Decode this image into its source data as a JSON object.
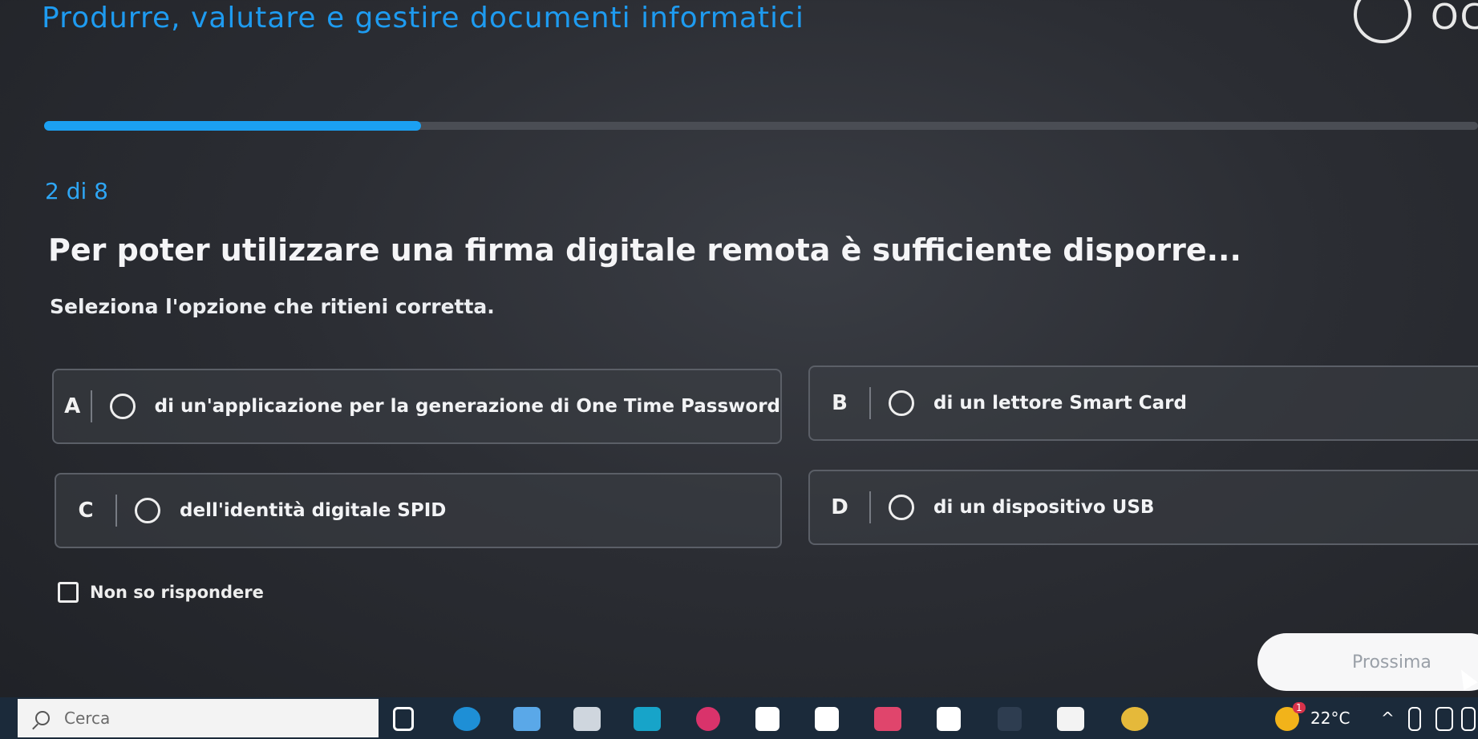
{
  "header": {
    "title": "Produrre, valutare e gestire documenti informatici",
    "timer_text": "OC"
  },
  "progress": {
    "fraction": 0.25,
    "counter": "2 di 8"
  },
  "question": {
    "text": "Per poter utilizzare una firma digitale remota è sufficiente disporre...",
    "instruction": "Seleziona l'opzione che ritieni corretta."
  },
  "options": [
    {
      "letter": "A",
      "label": "di un'applicazione per la generazione di One Time Password"
    },
    {
      "letter": "B",
      "label": "di un lettore Smart Card"
    },
    {
      "letter": "C",
      "label": "dell'identità digitale SPID"
    },
    {
      "letter": "D",
      "label": "di un dispositivo USB"
    }
  ],
  "no_answer": {
    "label": "Non so rispondere"
  },
  "next_button": {
    "label": "Prossima"
  },
  "taskbar": {
    "search_placeholder": "Cerca",
    "temperature": "22°C",
    "weather_badge": "1",
    "pinned_icons": [
      "task-view-icon",
      "edge-icon",
      "file-explorer-icon",
      "store-icon",
      "outlook-icon",
      "app-icon",
      "app-icon",
      "app-icon",
      "app-icon",
      "app-icon",
      "app-icon",
      "app-icon",
      "chrome-icon"
    ]
  },
  "colors": {
    "accent": "#1ba0f2",
    "background": "#2b2d33",
    "button": "#f7f7f8"
  }
}
